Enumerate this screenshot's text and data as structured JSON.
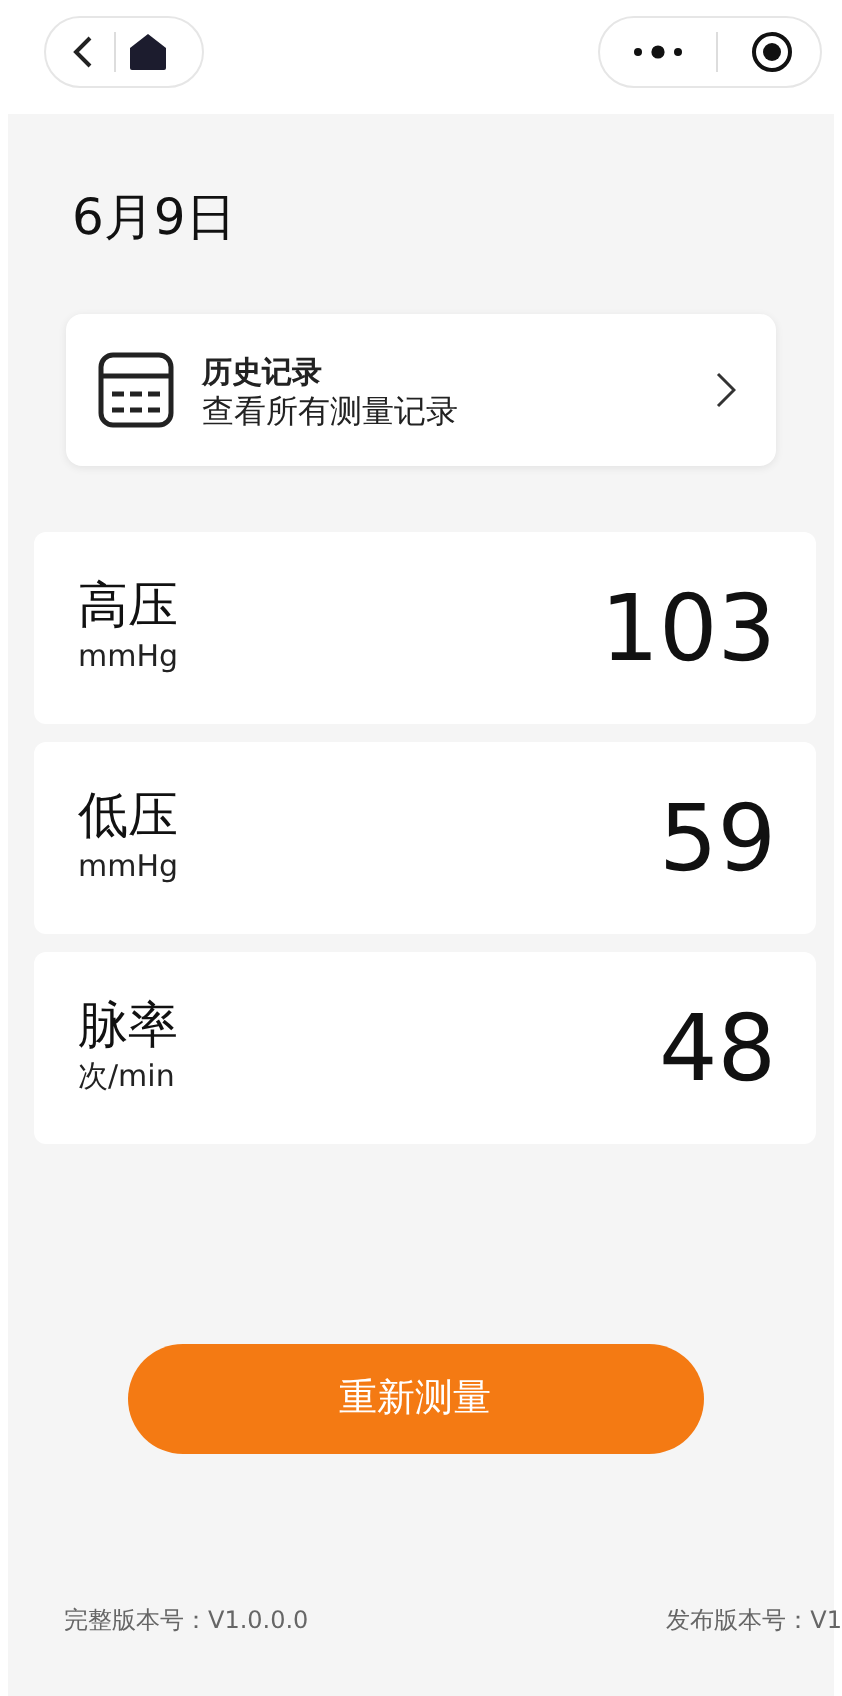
{
  "date": "6月9日",
  "history": {
    "title": "历史记录",
    "subtitle": "查看所有测量记录"
  },
  "metrics": [
    {
      "name": "高压",
      "unit": "mmHg",
      "value": "103"
    },
    {
      "name": "低压",
      "unit": "mmHg",
      "value": "59"
    },
    {
      "name": "脉率",
      "unit": "次/min",
      "value": "48"
    }
  ],
  "remeasure_button": "重新测量",
  "footer": {
    "full_version": "完整版本号：V1.0.0.0",
    "release_version": "发布版本号：V1"
  }
}
